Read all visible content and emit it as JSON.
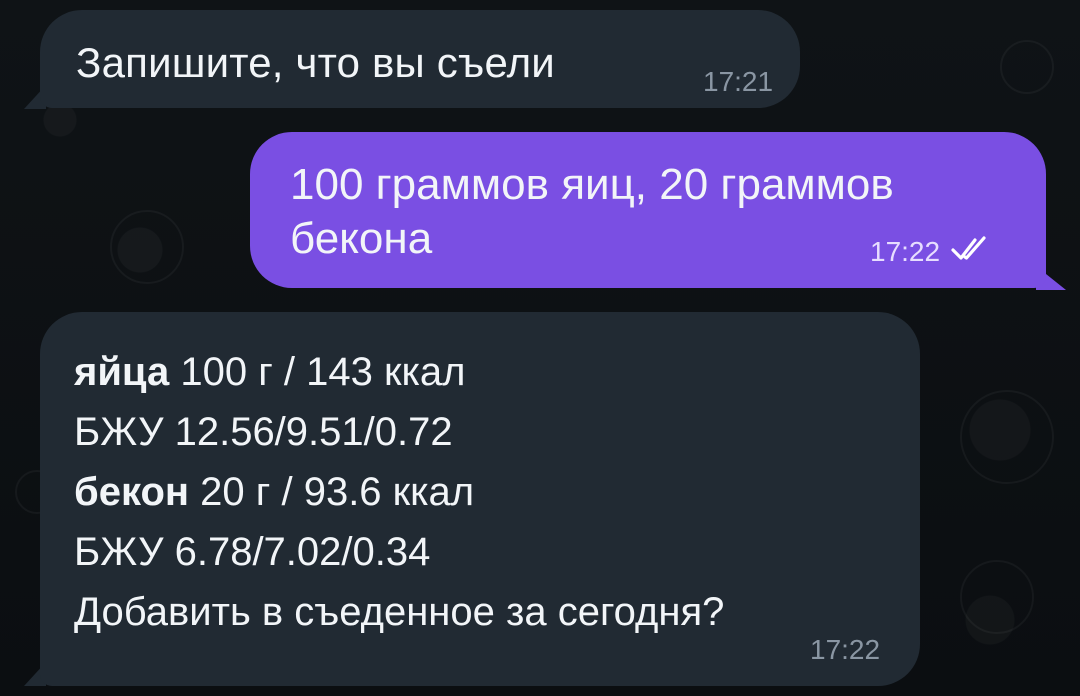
{
  "messages": [
    {
      "text": "Запишите, что вы съели",
      "time": "17:21"
    },
    {
      "lines": [
        "100 граммов яиц, 20 граммов",
        "бекона"
      ],
      "time": "17:22",
      "status": "read"
    },
    {
      "rows": [
        {
          "bold": "яйца",
          "text": " 100 г / 143 ккал"
        },
        {
          "text": "БЖУ 12.56/9.51/0.72"
        },
        {
          "bold": "бекон",
          "text": " 20 г / 93.6 ккал"
        },
        {
          "text": "БЖУ 6.78/7.02/0.34"
        },
        {
          "text": "Добавить в съеденное за сегодня?"
        }
      ],
      "time": "17:22"
    }
  ],
  "colors": {
    "incoming": "#212a33",
    "outgoing": "#7a4fe3",
    "background": "#0c1013"
  },
  "icons": [
    "double-check-icon"
  ]
}
